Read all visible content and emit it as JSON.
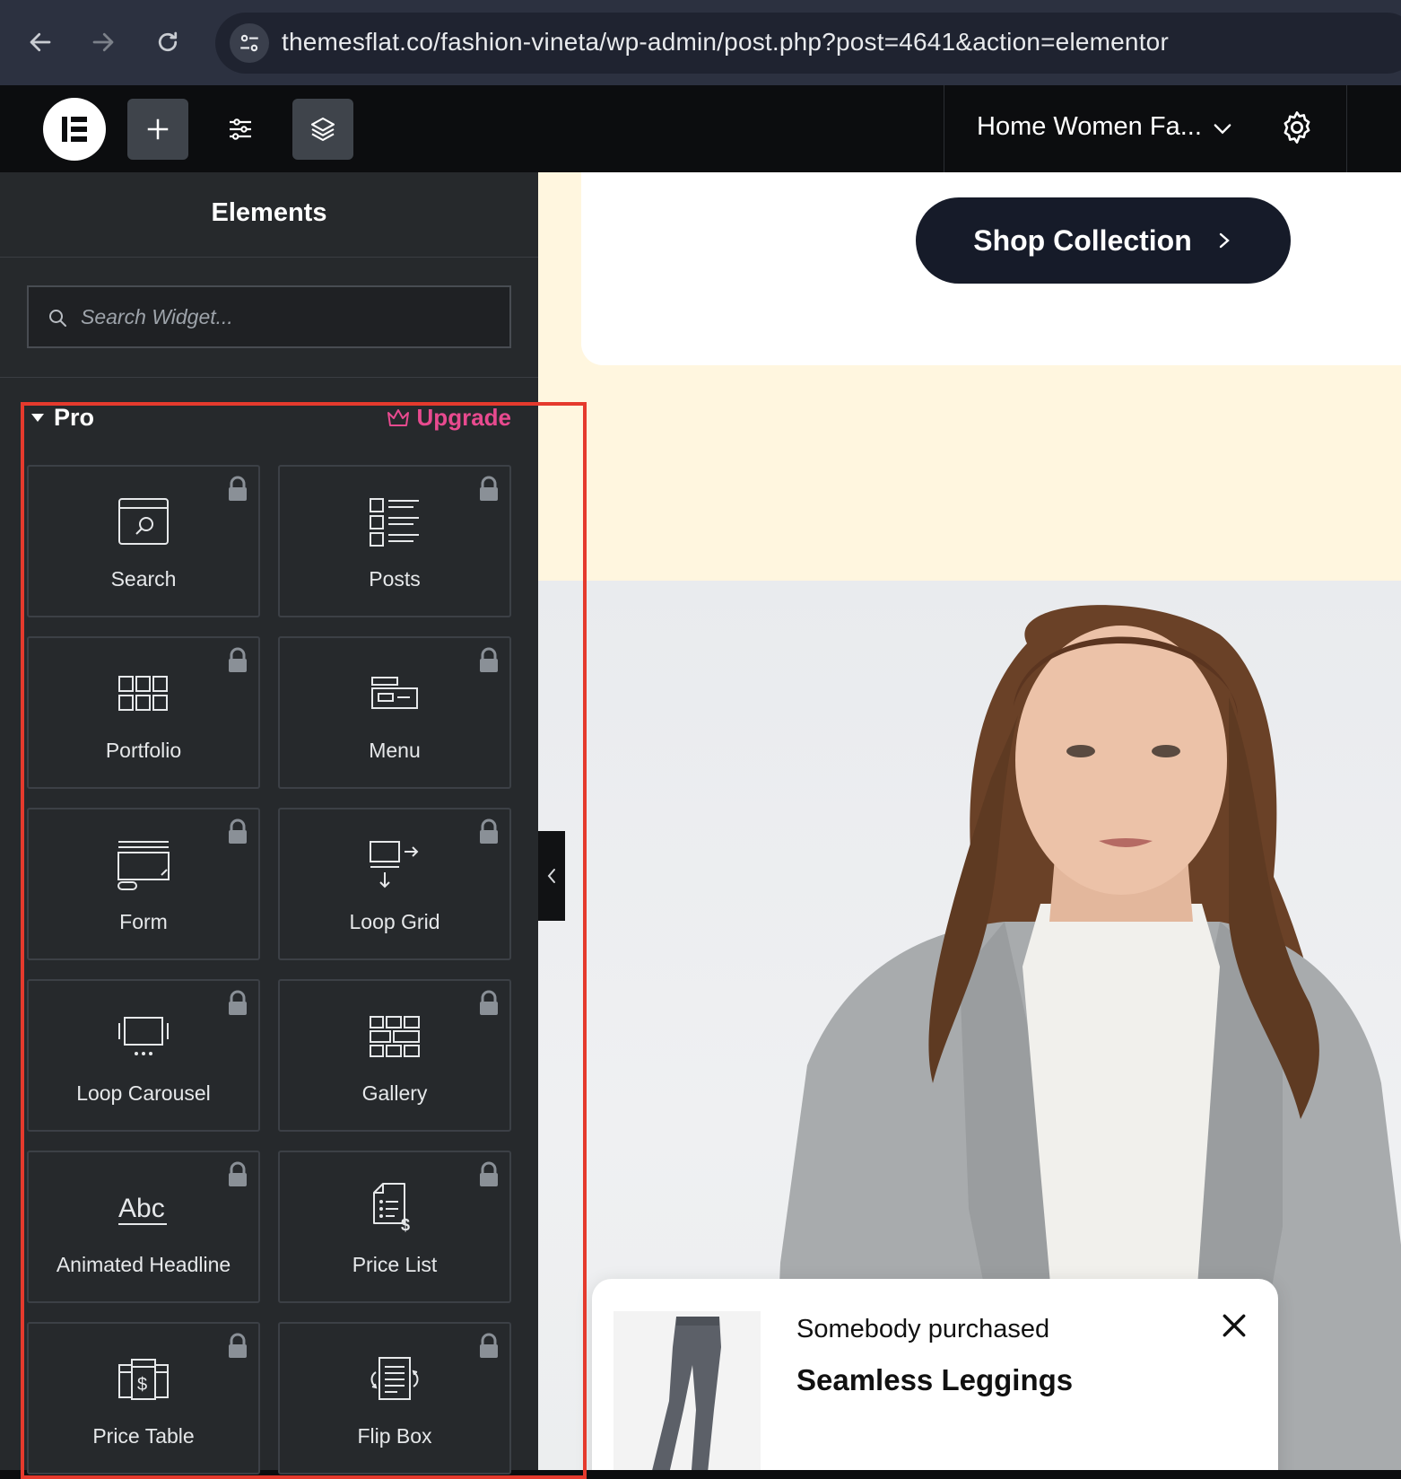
{
  "browser": {
    "url_host": "themesflat.co",
    "url_path": "/fashion-vineta/wp-admin/post.php?post=4641&action=elementor"
  },
  "topbar": {
    "document_title": "Home Women Fa..."
  },
  "panel": {
    "title": "Elements",
    "search_placeholder": "Search Widget...",
    "section_label": "Pro",
    "upgrade_label": "Upgrade",
    "widgets": [
      {
        "label": "Search",
        "icon": "search-widget-icon"
      },
      {
        "label": "Posts",
        "icon": "posts-icon"
      },
      {
        "label": "Portfolio",
        "icon": "portfolio-icon"
      },
      {
        "label": "Menu",
        "icon": "menu-icon"
      },
      {
        "label": "Form",
        "icon": "form-icon"
      },
      {
        "label": "Loop Grid",
        "icon": "loop-grid-icon"
      },
      {
        "label": "Loop Carousel",
        "icon": "loop-carousel-icon"
      },
      {
        "label": "Gallery",
        "icon": "gallery-icon"
      },
      {
        "label": "Animated Headline",
        "icon": "animated-headline-icon"
      },
      {
        "label": "Price List",
        "icon": "price-list-icon"
      },
      {
        "label": "Price Table",
        "icon": "price-table-icon"
      },
      {
        "label": "Flip Box",
        "icon": "flip-box-icon"
      }
    ]
  },
  "canvas": {
    "shop_button_label": "Shop Collection",
    "toast_line1": "Somebody purchased",
    "toast_line2": "Seamless Leggings",
    "toast_line3": "",
    "colors": {
      "accent": "#e84a8f",
      "highlight_border": "#e53a2d",
      "button_bg": "#161b29",
      "hero_bg": "#fff6df"
    }
  }
}
